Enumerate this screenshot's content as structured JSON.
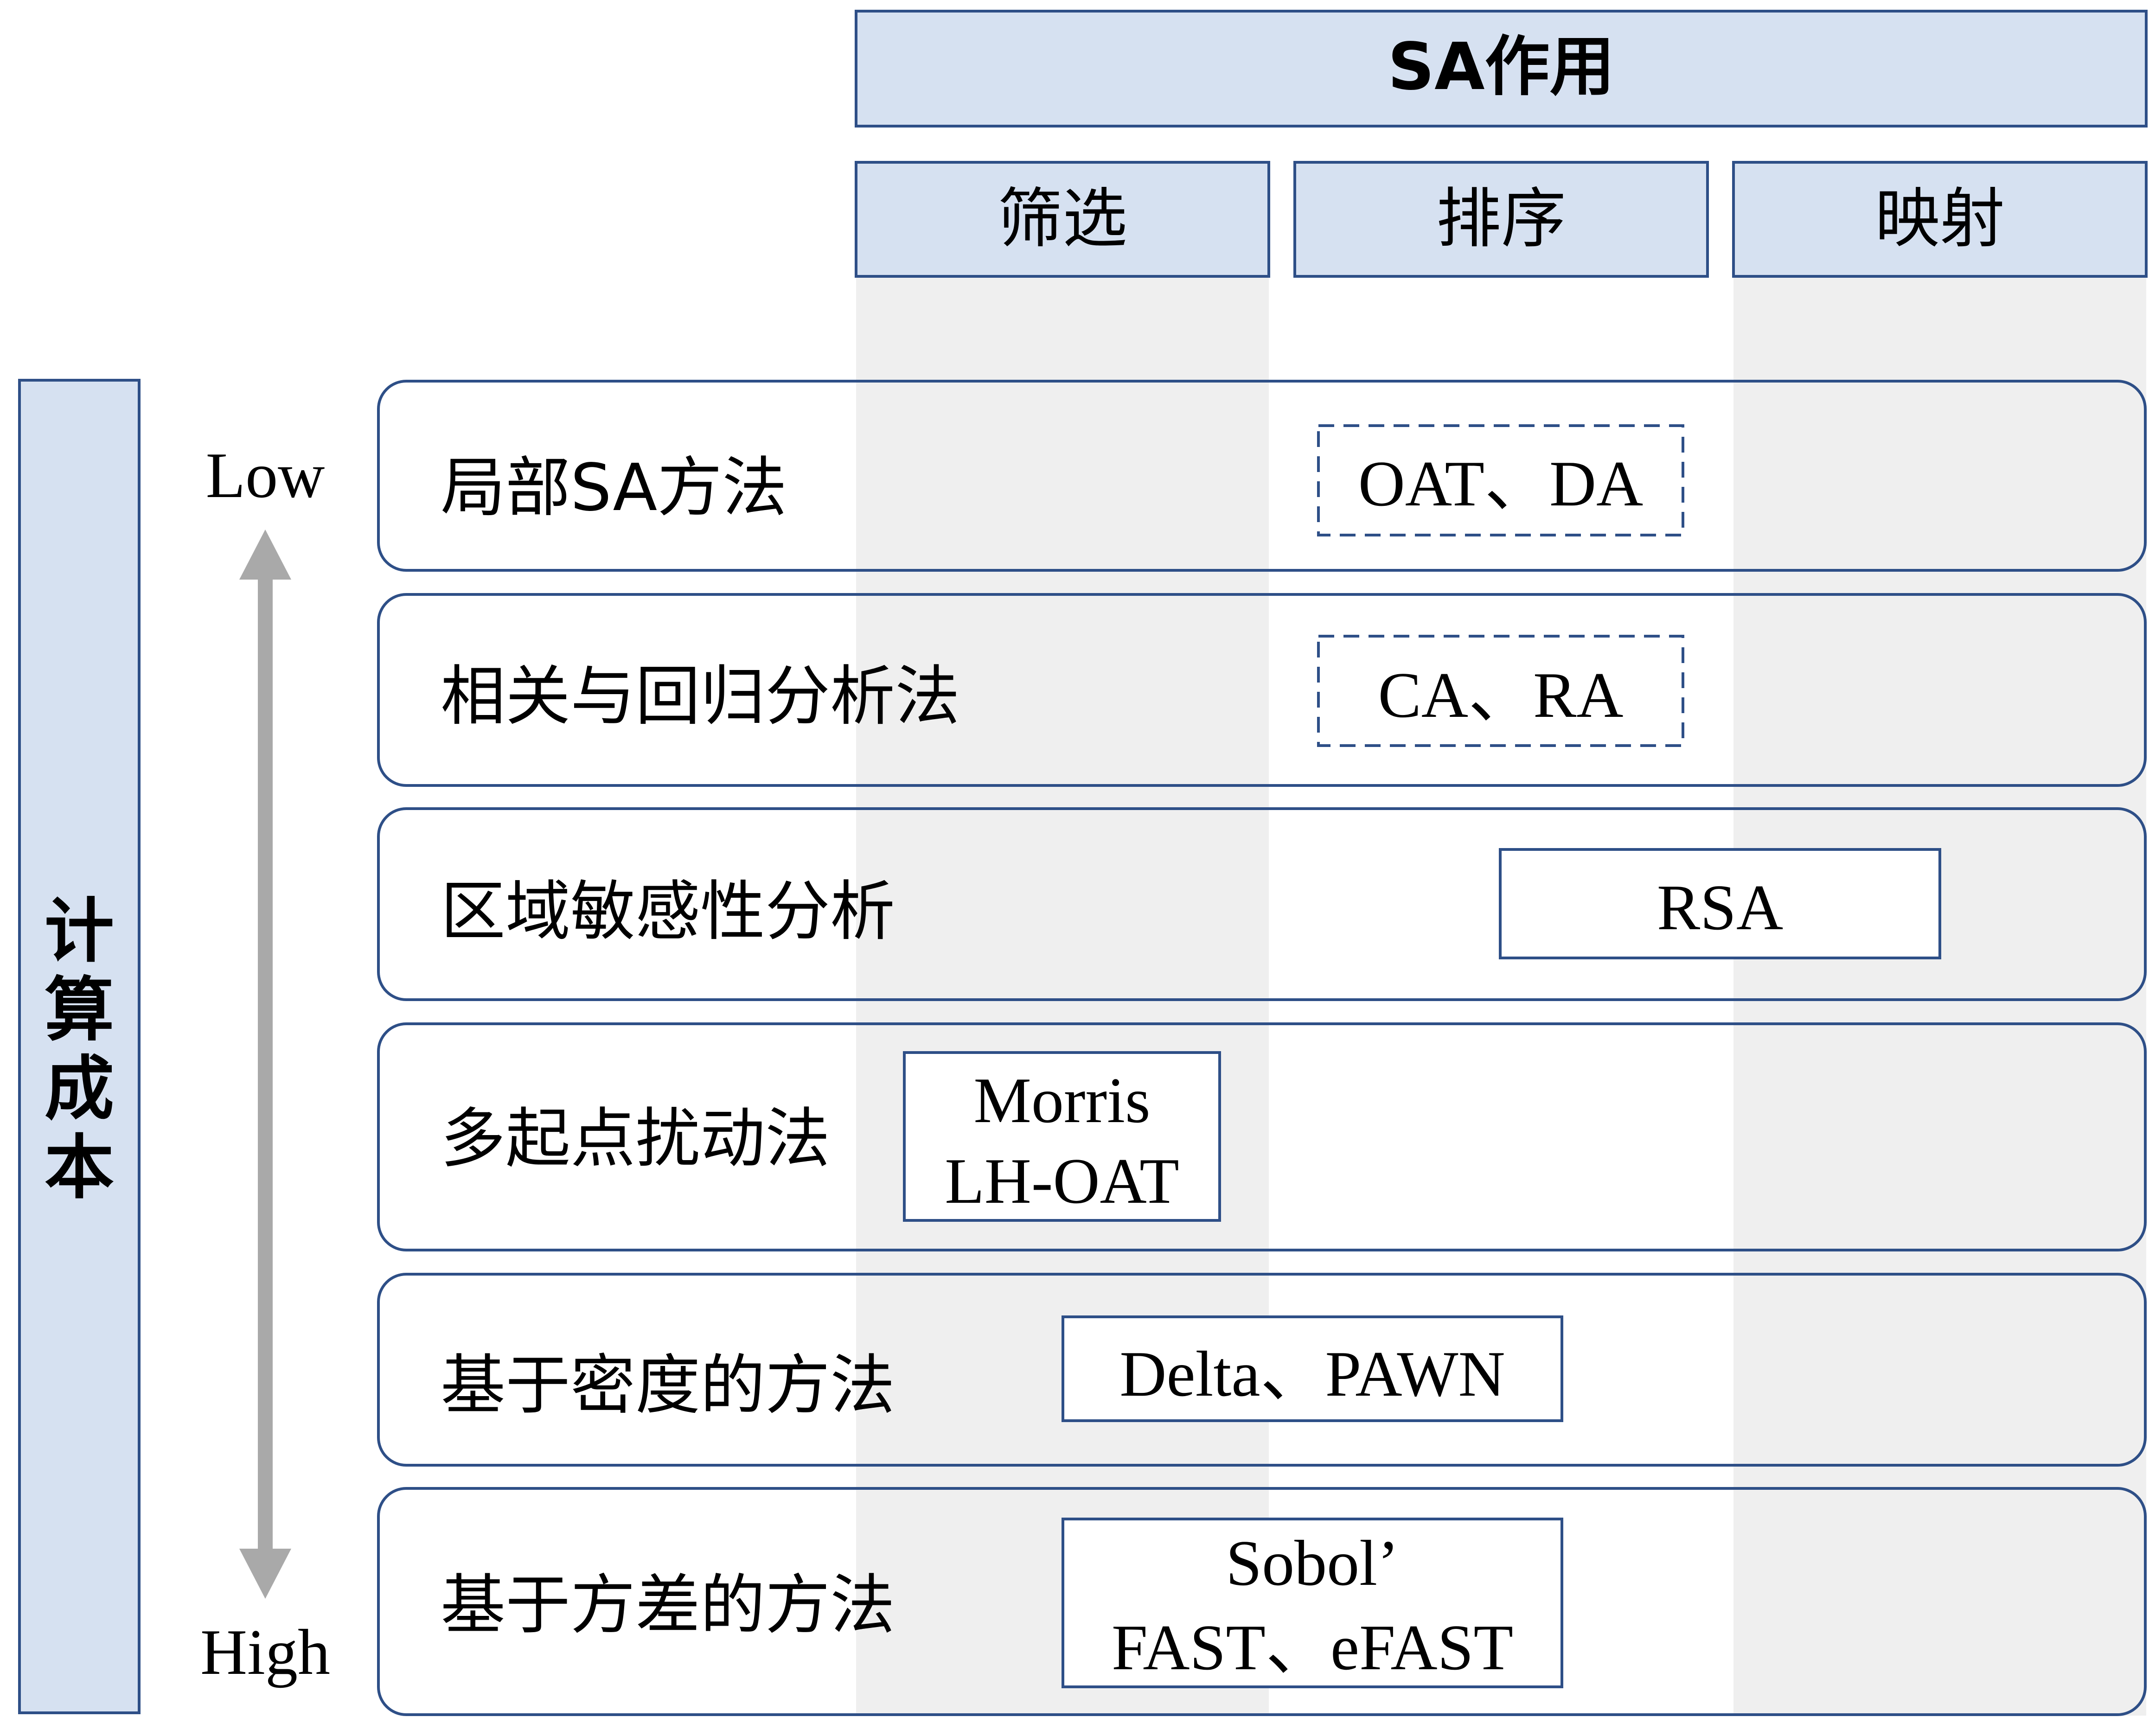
{
  "header": {
    "title": "SA作用"
  },
  "columns": [
    "筛选",
    "排序",
    "映射"
  ],
  "cost_axis": {
    "label": "计算成本",
    "low": "Low",
    "high": "High"
  },
  "rows": [
    {
      "label": "局部SA方法",
      "methods": [
        "OAT、DA"
      ],
      "style": "dashed"
    },
    {
      "label": "相关与回归分析法",
      "methods": [
        "CA、RA"
      ],
      "style": "dashed"
    },
    {
      "label": "区域敏感性分析",
      "methods": [
        "RSA"
      ],
      "style": "solid"
    },
    {
      "label": "多起点扰动法",
      "methods": [
        "Morris",
        "LH-OAT"
      ],
      "style": "solid"
    },
    {
      "label": "基于密度的方法",
      "methods": [
        "Delta、PAWN"
      ],
      "style": "solid"
    },
    {
      "label": "基于方差的方法",
      "methods": [
        "Sobol’",
        "FAST、eFAST"
      ],
      "style": "solid"
    }
  ],
  "colors": {
    "header_fill": "#d6e1f1",
    "border": "#2e4f87",
    "column_shade": "#efefef",
    "arrow": "#a9a9a9"
  }
}
